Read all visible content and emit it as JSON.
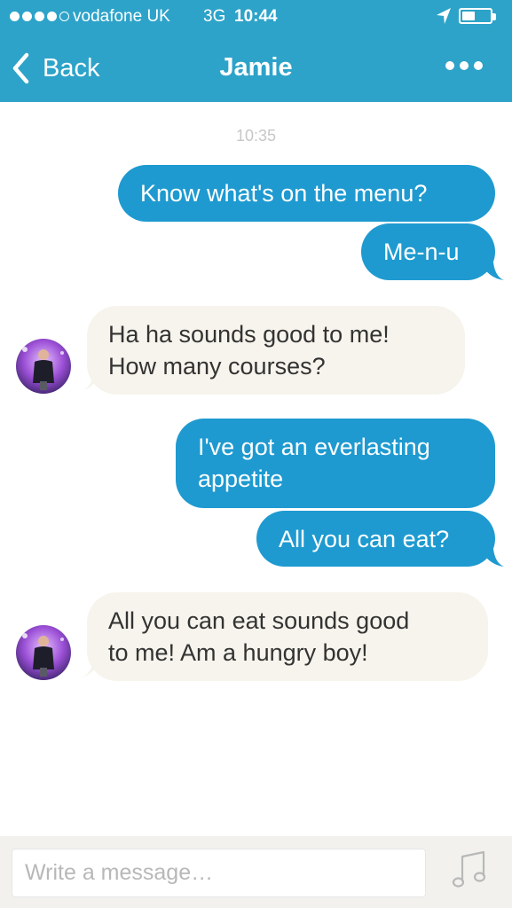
{
  "status_bar": {
    "signal_dots": 5,
    "signal_filled": 4,
    "carrier": "vodafone UK",
    "network": "3G",
    "time": "10:44",
    "location_icon": "location-arrow-icon",
    "battery_level": 0.45
  },
  "nav": {
    "back_label": "Back",
    "back_icon": "chevron-left-icon",
    "title": "Jamie",
    "more_icon": "more-dots-icon"
  },
  "conversation": {
    "timestamp": "10:35",
    "messages": [
      {
        "direction": "outgoing",
        "lines": [
          "Know what's on the menu?"
        ]
      },
      {
        "direction": "outgoing",
        "lines": [
          "Me-n-u"
        ]
      },
      {
        "direction": "incoming",
        "lines": [
          "Ha ha sounds good to me!",
          "How many courses?"
        ]
      },
      {
        "direction": "outgoing",
        "lines": [
          "I've got an everlasting",
          "appetite"
        ]
      },
      {
        "direction": "outgoing",
        "lines": [
          "All you can eat?"
        ]
      },
      {
        "direction": "incoming",
        "lines": [
          "All you can eat sounds good",
          "to me! Am a hungry boy!"
        ]
      }
    ]
  },
  "composer": {
    "placeholder": "Write a message…",
    "value": "",
    "music_icon": "music-note-icon"
  },
  "colors": {
    "header": "#2da3c9",
    "outgoing_bubble": "#1e9ad0",
    "incoming_bubble": "#f6f4ec",
    "composer_bg": "#f2f1ee"
  }
}
